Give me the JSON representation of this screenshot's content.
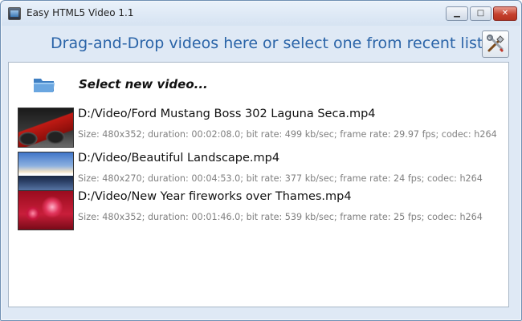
{
  "window": {
    "title": "Easy HTML5 Video 1.1",
    "controls": {
      "minimize": "▁",
      "maximize": "□",
      "close": "✕"
    }
  },
  "header": {
    "instruction": "Drag-and-Drop videos here or select one from recent list",
    "settings_icon": "tools-icon"
  },
  "select_new": {
    "label": "Select new video...",
    "icon": "folder-icon"
  },
  "recent_videos": [
    {
      "path": "D:/Video/Ford Mustang Boss 302 Laguna Seca.mp4",
      "details": "Size: 480x352; duration: 00:02:08.0; bit rate: 499 kb/sec; frame rate: 29.97 fps; codec: h264"
    },
    {
      "path": "D:/Video/Beautiful Landscape.mp4",
      "details": "Size: 480x270; duration: 00:04:53.0; bit rate: 377 kb/sec; frame rate: 24 fps; codec: h264"
    },
    {
      "path": "D:/Video/New Year fireworks over Thames.mp4",
      "details": "Size: 480x352; duration: 00:01:46.0; bit rate: 539 kb/sec; frame rate: 25 fps; codec: h264"
    }
  ],
  "colors": {
    "header_text": "#2a64a8",
    "meta_text": "#808080",
    "close_button": "#c5402d"
  }
}
